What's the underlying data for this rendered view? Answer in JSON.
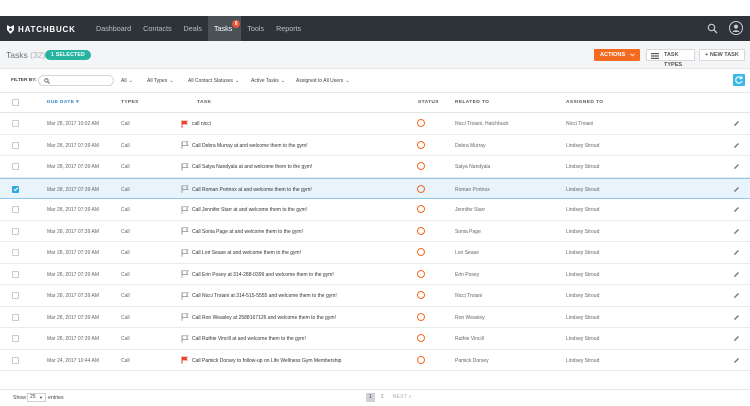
{
  "brand": {
    "logo_text": "HATCHBUCK"
  },
  "nav": {
    "items": [
      {
        "label": "Dashboard"
      },
      {
        "label": "Contacts"
      },
      {
        "label": "Deals"
      },
      {
        "label": "Tasks",
        "badge": "6"
      },
      {
        "label": "Tools"
      },
      {
        "label": "Reports"
      }
    ],
    "active": "Tasks"
  },
  "header": {
    "title": "Tasks",
    "count": "(32)",
    "selected_pill": "1 SELECTED",
    "actions_label": "ACTIONS",
    "task_types_label": "TASK TYPES",
    "new_task_label": "+ NEW TASK"
  },
  "filters": {
    "label": "FILTER BY:",
    "search_placeholder": "",
    "dropdowns": [
      {
        "label": "All"
      },
      {
        "label": "All Types"
      },
      {
        "label": "All Contact Statuses"
      },
      {
        "label": "Active Tasks"
      },
      {
        "label": "Assigned to All Users"
      }
    ]
  },
  "table": {
    "columns": {
      "due_date": "DUE DATE",
      "types": "TYPES",
      "task": "TASK",
      "status": "STATUS",
      "related_to": "RELATED TO",
      "assigned_to": "ASSIGNED TO"
    },
    "rows": [
      {
        "due": "Mar 28, 2017 10:02 AM",
        "type": "Call",
        "flag": "red",
        "task": "call nicci",
        "related": "Nicci Troiani, Hatchbuck",
        "assigned": "Nicci Troiani",
        "checked": false
      },
      {
        "due": "Mar 28, 2017 07:39 AM",
        "type": "Call",
        "flag": "outline",
        "task": "Call  Debra Murray at  and welcome them to the gym!",
        "related": "Debra Murray",
        "assigned": "Lindsey Stroud",
        "checked": false
      },
      {
        "due": "Mar 28, 2017 07:39 AM",
        "type": "Call",
        "flag": "outline",
        "task": "Call  Satya Nandyala at  and welcome them to the gym!",
        "related": "Satya Nandyala",
        "assigned": "Lindsey Stroud",
        "checked": false
      },
      {
        "due": "Mar 28, 2017 07:39 AM",
        "type": "Call",
        "flag": "outline",
        "task": "Call  Roman Portnox at  and welcome them to the gym!",
        "related": "Roman Portnox",
        "assigned": "Lindsey Stroud",
        "checked": true
      },
      {
        "due": "Mar 28, 2017 07:39 AM",
        "type": "Call",
        "flag": "outline",
        "task": "Call  Jennifer Starr at  and welcome them to the gym!",
        "related": "Jennifer Starr",
        "assigned": "Lindsey Stroud",
        "checked": false
      },
      {
        "due": "Mar 28, 2017 07:39 AM",
        "type": "Call",
        "flag": "outline",
        "task": "Call  Sonia Page at  and welcome them to the gym!",
        "related": "Sonia Page",
        "assigned": "Lindsey Stroud",
        "checked": false
      },
      {
        "due": "Mar 28, 2017 07:39 AM",
        "type": "Call",
        "flag": "outline",
        "task": "Call  Lori Sease at  and welcome them to the gym!",
        "related": "Lori Sease",
        "assigned": "Lindsey Stroud",
        "checked": false
      },
      {
        "due": "Mar 28, 2017 07:39 AM",
        "type": "Call",
        "flag": "outline",
        "task": "Call  Erin Posey at  314-288-0399 and welcome them to the gym!",
        "related": "Erin Posey",
        "assigned": "Lindsey Stroud",
        "checked": false
      },
      {
        "due": "Mar 28, 2017 07:39 AM",
        "type": "Call",
        "flag": "outline",
        "task": "Call  Nicci Troiani at  314-515-5555 and welcome them to the gym!",
        "related": "Nicci Troiani",
        "assigned": "Lindsey Stroud",
        "checked": false
      },
      {
        "due": "Mar 28, 2017 07:39 AM",
        "type": "Call",
        "flag": "outline",
        "task": "Call  Ron Weasley at  2588167126 and welcome them to the gym!",
        "related": "Ron Weasley",
        "assigned": "Lindsey Stroud",
        "checked": false
      },
      {
        "due": "Mar 28, 2017 07:39 AM",
        "type": "Call",
        "flag": "outline",
        "task": "Call  Ruthie Vincill at  and welcome them to the gym!",
        "related": "Ruthie Vincill",
        "assigned": "Lindsey Stroud",
        "checked": false
      },
      {
        "due": "Mar 24, 2017 10:44 AM",
        "type": "Call",
        "flag": "red",
        "task": "Call  Pamick Dorsey to follow-up on Life Wellness Gym Membership",
        "related": "Pamick Dorsey",
        "assigned": "Lindsey Stroud",
        "checked": false
      }
    ]
  },
  "footer": {
    "show_label": "Show",
    "page_size": "25",
    "entries_label": "entries",
    "pages": [
      "1",
      "2"
    ],
    "current_page": "1",
    "next_label": "NEXT »"
  },
  "colors": {
    "nav_bg": "#2d3338",
    "accent_orange": "#f26b21",
    "accent_teal": "#26b3a0",
    "accent_blue": "#2fa7de",
    "flag_red": "#e8452c"
  }
}
